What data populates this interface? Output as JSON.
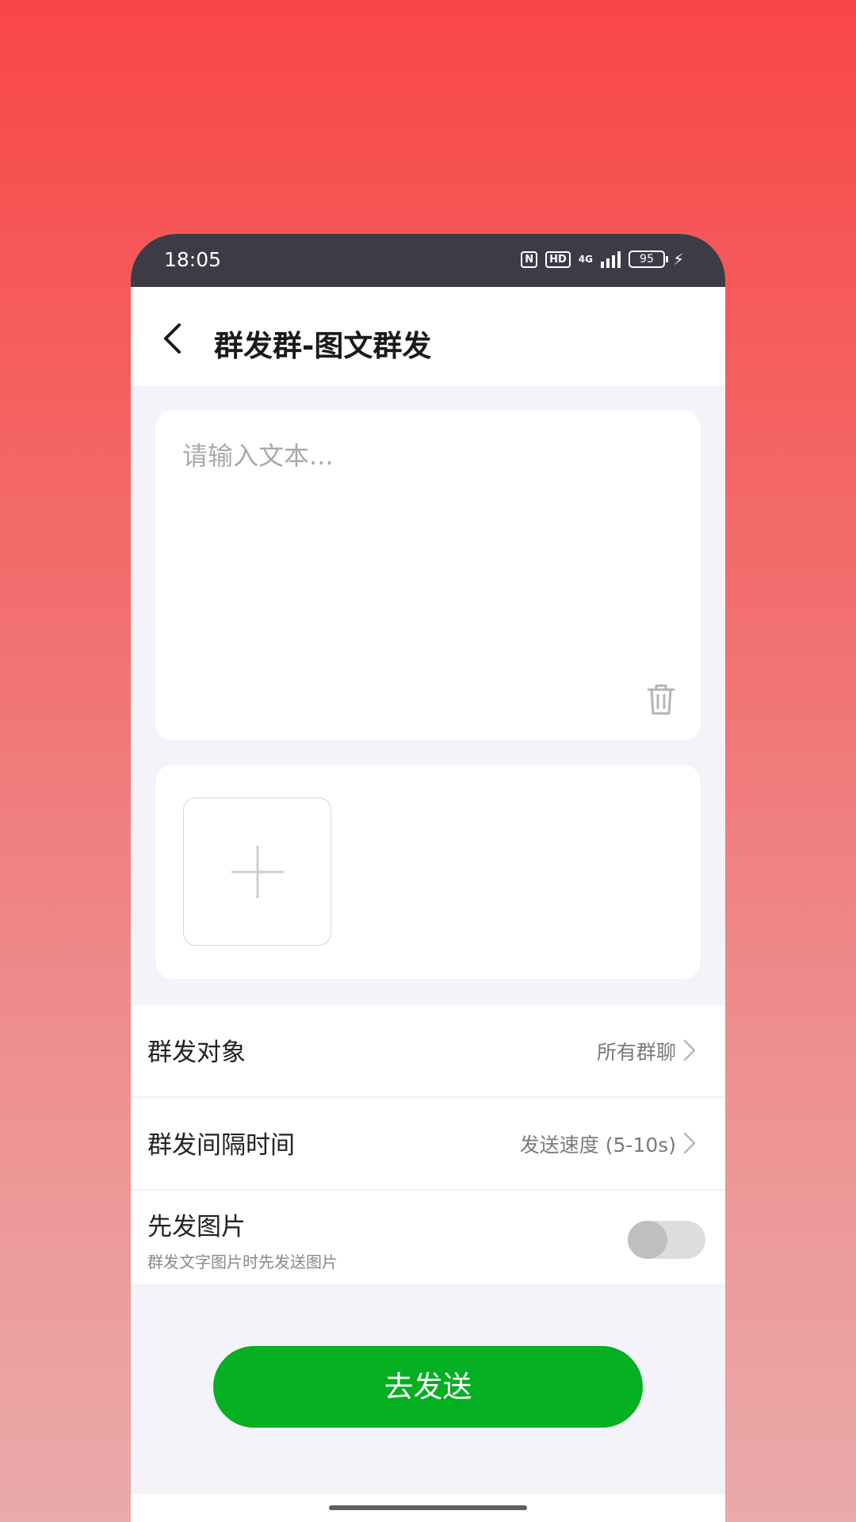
{
  "status_bar": {
    "time": "18:05",
    "nfc_icon_label": "N",
    "hd_badge": "HD",
    "network": "4G",
    "battery": "95"
  },
  "header": {
    "title": "群发群-图文群发"
  },
  "text_card": {
    "placeholder": "请输入文本...",
    "value": ""
  },
  "rows": {
    "target": {
      "label": "群发对象",
      "value": "所有群聊"
    },
    "interval": {
      "label": "群发间隔时间",
      "value": "发送速度 (5-10s)"
    },
    "image_first": {
      "label": "先发图片",
      "sublabel": "群发文字图片时先发送图片",
      "enabled": false
    }
  },
  "send_button": {
    "label": "去发送"
  },
  "colors": {
    "accent_green": "#04b021",
    "status_bar": "#3d3b47",
    "background_gradient_top": "#f94646",
    "background_gradient_bottom": "#eaaaaa"
  }
}
